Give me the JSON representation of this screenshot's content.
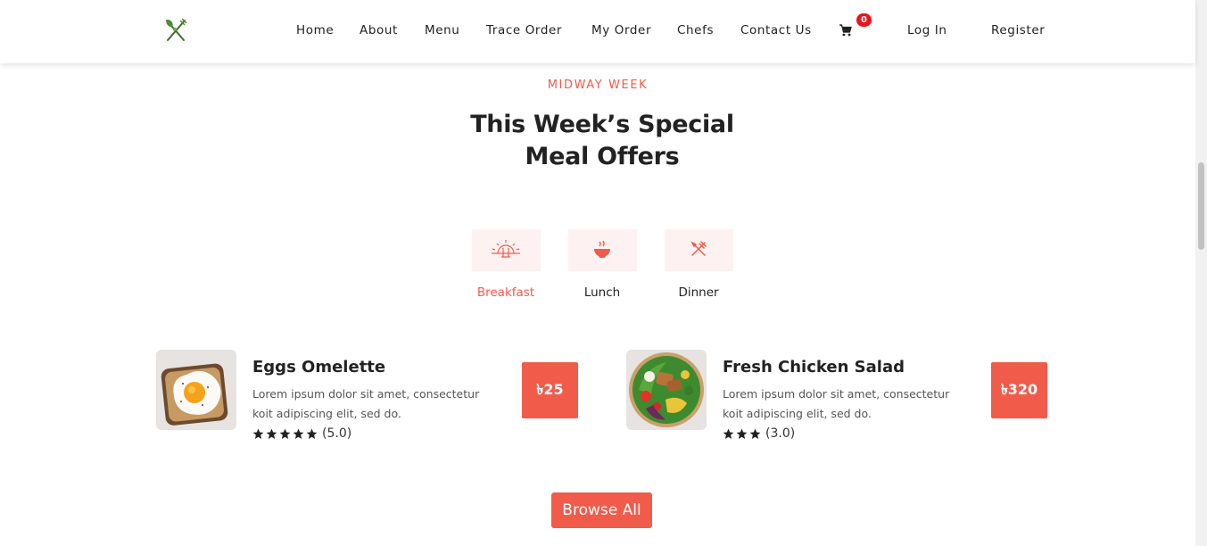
{
  "header": {
    "nav": [
      "Home",
      "About",
      "Menu",
      "Trace Order",
      "My Order",
      "Chefs",
      "Contact Us"
    ],
    "cart_count": "0",
    "login": "Log In",
    "register": "Register"
  },
  "section": {
    "eyebrow": "MIDWAY WEEK",
    "title_line1": "This Week’s Special",
    "title_line2": "Meal Offers"
  },
  "tabs": [
    {
      "label": "Breakfast",
      "icon": "sunrise-icon",
      "active": true
    },
    {
      "label": "Lunch",
      "icon": "bowl-icon",
      "active": false
    },
    {
      "label": "Dinner",
      "icon": "fork-knife-icon",
      "active": false
    }
  ],
  "meals": [
    {
      "name": "Eggs Omelette",
      "desc_line1": "Lorem ipsum dolor sit amet, consectetur",
      "desc_line2": "koit adipiscing elit, sed do.",
      "stars": 5,
      "rating": "(5.0)",
      "price": "৳25"
    },
    {
      "name": "Fresh Chicken Salad",
      "desc_line1": "Lorem ipsum dolor sit amet, consectetur",
      "desc_line2": "koit adipiscing elit, sed do.",
      "stars": 3,
      "rating": "(3.0)",
      "price": "৳320"
    }
  ],
  "browse_label": "Browse All",
  "colors": {
    "accent": "#f15b4a",
    "tab_bg": "#fdf2f1",
    "text": "#222222",
    "badge": "#e8141a"
  }
}
